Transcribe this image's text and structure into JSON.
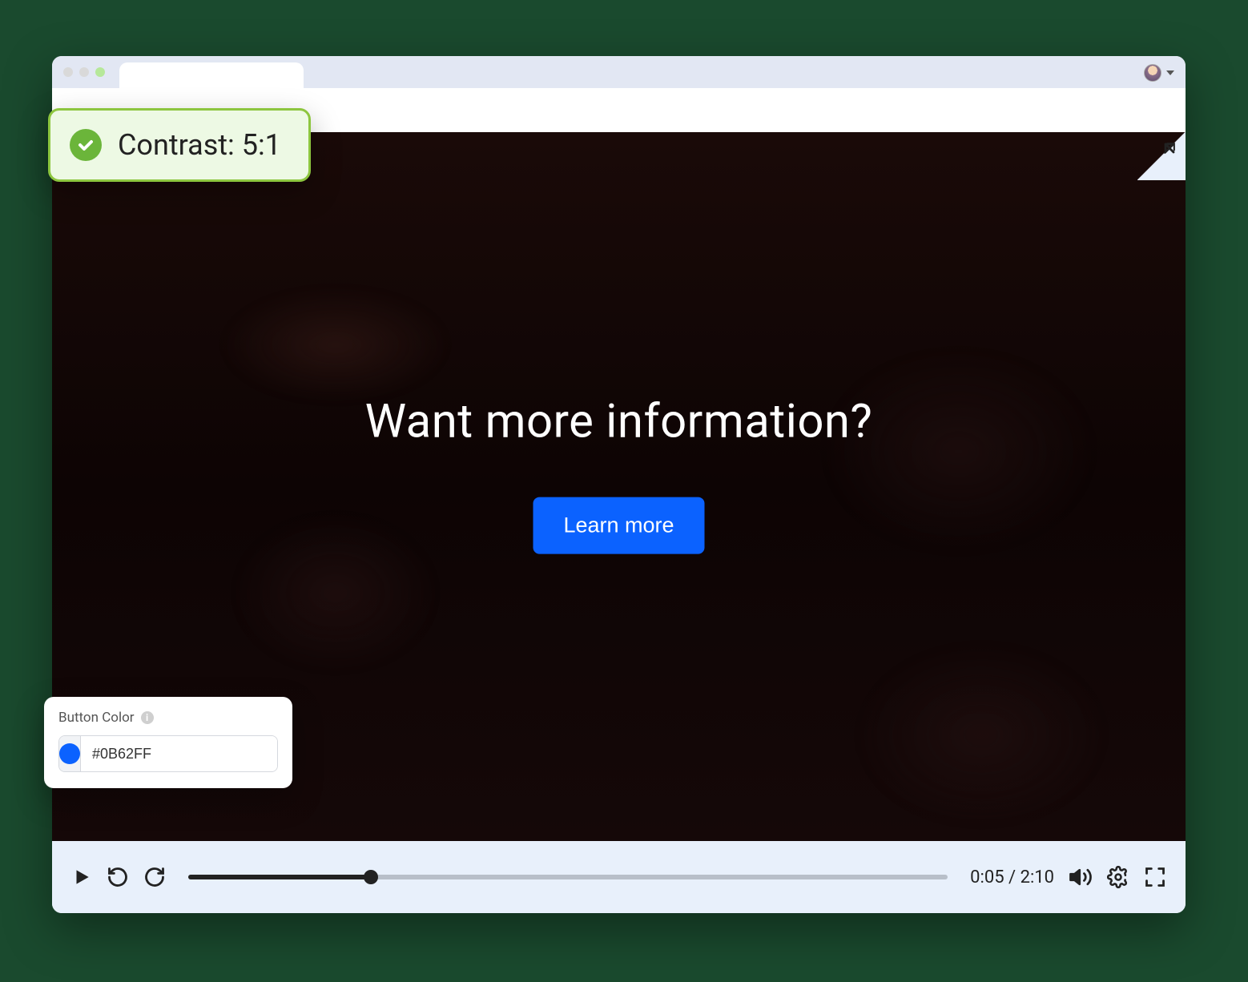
{
  "contrast_badge": {
    "label": "Contrast: 5:1"
  },
  "cta": {
    "heading": "Want more information?",
    "button_label": "Learn more"
  },
  "player": {
    "current_time": "0:05",
    "total_time": "2:10"
  },
  "color_panel": {
    "title": "Button Color",
    "hex": "#0B62FF"
  },
  "colors": {
    "button_bg": "#0B62FF"
  }
}
